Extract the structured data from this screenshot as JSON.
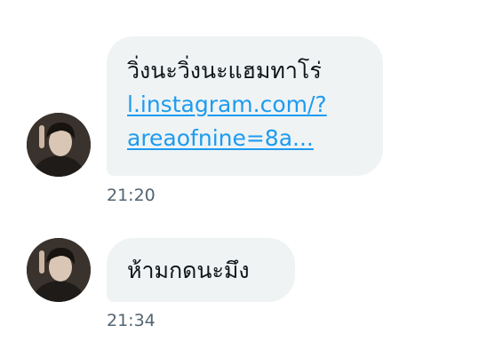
{
  "messages": [
    {
      "text": "วิ่งนะวิ่งนะแฮมทาโร่",
      "link_line_1": "l.instagram.com/?",
      "link_line_2": "areaofnine=8a...",
      "time": "21:20",
      "avatar_icon": "user-photo-avatar"
    },
    {
      "text": "ห้ามกดนะมึง",
      "time": "21:34",
      "avatar_icon": "user-photo-avatar"
    }
  ],
  "colors": {
    "bubble": "#eff3f4",
    "text": "#0f1419",
    "link": "#1d9bf0",
    "timestamp": "#536471"
  }
}
